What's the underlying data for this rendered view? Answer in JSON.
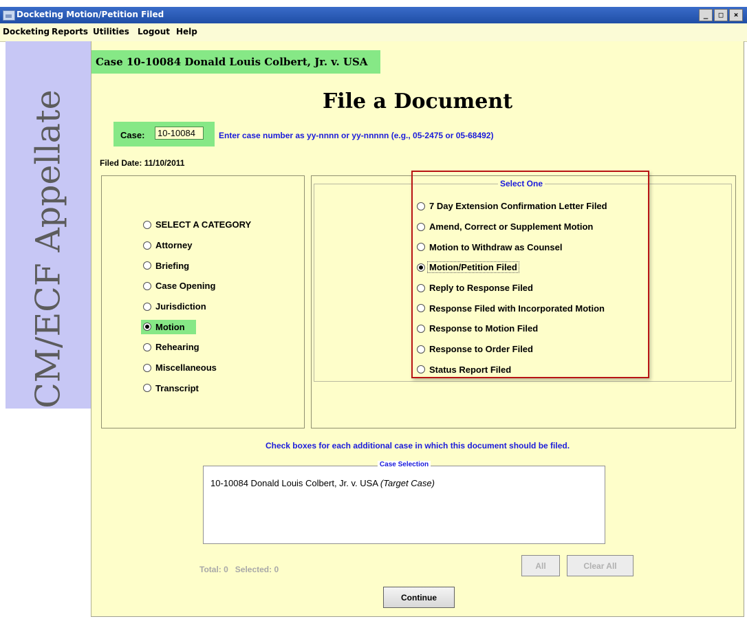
{
  "window": {
    "title": "Docketing Motion/Petition Filed"
  },
  "menu": {
    "items": [
      "Docketing",
      "Reports",
      "Utilities",
      "Logout",
      "Help"
    ]
  },
  "sidebar": {
    "logo_text": "CM/ECF Appellate"
  },
  "header": {
    "case_banner": "Case 10-10084 Donald Louis Colbert, Jr. v. USA"
  },
  "page": {
    "title": "File a Document"
  },
  "case_entry": {
    "label": "Case:",
    "value": "10-10084",
    "hint": "Enter case number as yy-nnnn or yy-nnnnn (e.g., 05-2475 or 05-68492)"
  },
  "filed_date": {
    "label": "Filed Date:",
    "value": "11/10/2011"
  },
  "categories": {
    "items": [
      "SELECT A CATEGORY",
      "Attorney",
      "Briefing",
      "Case Opening",
      "Jurisdiction",
      "Motion",
      "Rehearing",
      "Miscellaneous",
      "Transcript"
    ],
    "selected": "Motion"
  },
  "document_types": {
    "legend": "Select One",
    "items": [
      "7 Day Extension Confirmation Letter Filed",
      "Amend, Correct or Supplement Motion",
      "Motion to Withdraw as Counsel",
      "Motion/Petition Filed",
      "Reply to Response Filed",
      "Response Filed with Incorporated Motion",
      "Response to Motion Filed",
      "Response to Order Filed",
      "Status Report Filed"
    ],
    "selected": "Motion/Petition Filed"
  },
  "additional_cases": {
    "instruction": "Check boxes for each additional case in which this document should be filed.",
    "legend": "Case Selection",
    "rows": [
      {
        "case": "10-10084 Donald Louis Colbert, Jr. v. USA",
        "note": "(Target Case)"
      }
    ],
    "totals": "Total: 0   Selected: 0"
  },
  "buttons": {
    "all": "All",
    "clear_all": "Clear All",
    "continue": "Continue"
  },
  "colors": {
    "highlight_green": "#86e886",
    "panel_bg": "#fefeca",
    "link_blue": "#1a1adb",
    "sidebar_bg": "#c7c7f5",
    "annotation_red": "#b81414"
  }
}
